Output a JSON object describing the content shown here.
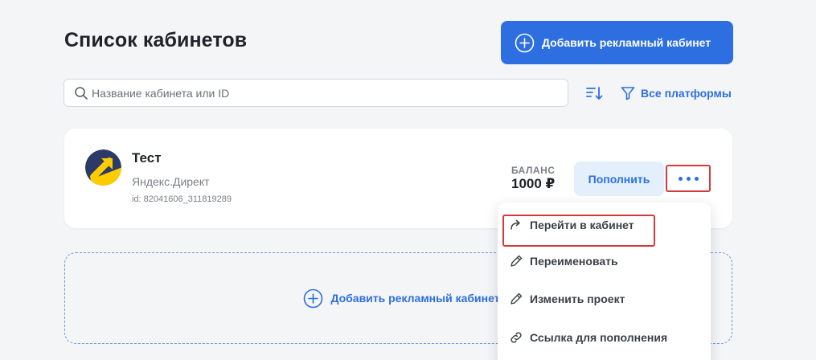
{
  "header": {
    "title": "Список кабинетов",
    "add_button_label": "Добавить рекламный кабинет"
  },
  "search": {
    "placeholder": "Название кабинета или ID",
    "value": ""
  },
  "filter": {
    "platform_label": "Все платформы"
  },
  "account": {
    "name": "Тест",
    "platform": "Яндекс.Директ",
    "id": "id: 82041606_311819289",
    "balance_label": "БАЛАНС",
    "balance_value": "1000 ₽",
    "topup_label": "Пополнить"
  },
  "add_card": {
    "label": "Добавить рекламный кабинет"
  },
  "menu": {
    "items": [
      {
        "label": "Перейти в кабинет",
        "icon": "redirect-arrow-icon"
      },
      {
        "label": "Переименовать",
        "icon": "pencil-icon"
      },
      {
        "label": "Изменить проект",
        "icon": "pencil-icon"
      },
      {
        "label": "Ссылка для пополнения",
        "icon": "link-icon"
      }
    ]
  },
  "colors": {
    "accent": "#2d6fe0",
    "highlight_border": "#d23b3b",
    "background": "#f4f5f7"
  }
}
